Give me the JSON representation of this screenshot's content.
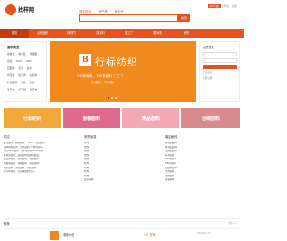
{
  "header": {
    "logo_text": "找样网",
    "logo_sub": "zaoyang.com",
    "search_tabs": [
      "搜索供应",
      "找产品",
      "找企业"
    ],
    "search_button": "搜索",
    "top_links": [
      "APP下载",
      "登录",
      "注册"
    ]
  },
  "nav": [
    "首页",
    "纺织面料",
    "找样衣",
    "找布料",
    "找工厂",
    "要采购",
    "资讯"
  ],
  "categories": {
    "title": "面料类型",
    "rows": [
      [
        "春夏装",
        "秋冬装",
        "羽绒服"
      ],
      [
        "真丝",
        "T400",
        "T800"
      ],
      [
        "四面弹",
        "天丝",
        "氨纶"
      ],
      [
        "印花布",
        "提花布",
        "色织布"
      ],
      [
        "针织面料",
        "涤纶",
        "锦纶"
      ],
      [
        "牛仔布",
        "灯芯绒",
        "棉麻布"
      ]
    ]
  },
  "banner": {
    "logo": "B",
    "title": "行标纺织",
    "line1": "250多面料，150多面料（工厂）",
    "line2": "价格低，200起",
    "colors": {
      "bg": "#f0891e",
      "accent": "#e8521e"
    }
  },
  "login": {
    "title": "会员登录",
    "link": "忘记密码",
    "register": "免费注册"
  },
  "ads": [
    {
      "text": "行标纺织",
      "bg": "#f2a93b"
    },
    {
      "text": "服装面料",
      "bg": "#e06a8b"
    },
    {
      "text": "精品面料",
      "bg": "#f5a7b3"
    },
    {
      "text": "羽绒面料",
      "bg": "#d98a8a"
    }
  ],
  "columns": [
    {
      "title": "供应",
      "items": [
        "专注面料、服装面料、T400、针织面料...",
        "面料布料提供、户外面料、T800面料...",
        "供应T400面料、面料供应商T400面料...",
        "春夏装面料、真丝面料等面料批发...",
        "四面弹面料、天丝面料、氨纶面料...",
        "羽绒服面料、春秋面料、棉麻面料...",
        "针织面料、涤纶面料、锦纶面料...",
        "牛仔布面料、灯芯绒面料供应..."
      ]
    },
    {
      "title": "采购信息",
      "items": [
        "找布",
        "找布",
        "找布",
        "找布",
        "找布",
        "找布",
        "找布",
        "找布",
        "找布",
        "更多采购"
      ]
    },
    {
      "title": "服装面料",
      "items": [
        "春夏装面料",
        "秋冬装面料",
        "羽绒服面料",
        "真丝面料",
        "T400面料",
        "T800面料",
        "四面弹面料",
        "天丝面料",
        "氨纶面料",
        "更多面料"
      ]
    }
  ],
  "recommend": {
    "title": "推荐",
    "more": "更多>>",
    "row": {
      "name": "涤棉纱纺",
      "price": "5.0 元/米",
      "date": "2023-07-11"
    }
  }
}
